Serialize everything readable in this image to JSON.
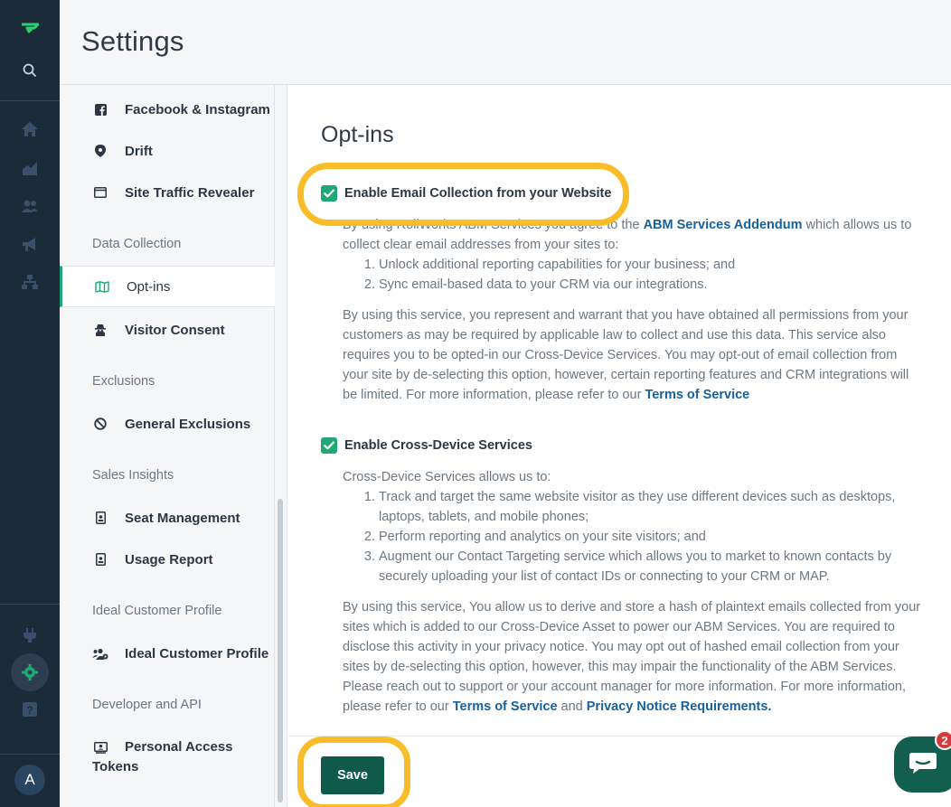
{
  "header": {
    "title": "Settings"
  },
  "rail": {
    "icons": [
      "brand-logo-icon",
      "search-icon",
      "home-icon",
      "chart-icon",
      "users-icon",
      "megaphone-icon",
      "org-chart-icon",
      "plug-icon",
      "gear-icon",
      "help-icon"
    ],
    "avatar_initial": "A"
  },
  "sidebar": {
    "items": [
      {
        "label": "Facebook & Instagram",
        "icon": "facebook-icon"
      },
      {
        "label": "Drift",
        "icon": "drift-icon"
      },
      {
        "label": "Site Traffic Revealer",
        "icon": "browser-window-icon"
      },
      {
        "label": "Opt-ins",
        "icon": "map-icon"
      },
      {
        "label": "Visitor Consent",
        "icon": "incognito-icon"
      },
      {
        "label": "General Exclusions",
        "icon": "ban-icon"
      },
      {
        "label": "Seat Management",
        "icon": "id-badge-icon"
      },
      {
        "label": "Usage Report",
        "icon": "id-badge-icon"
      },
      {
        "label": "Ideal Customer Profile",
        "icon": "users-cog-icon"
      },
      {
        "label": "Personal Access",
        "label2": "Tokens",
        "icon": "id-card-icon"
      }
    ],
    "sections": {
      "data_collection": "Data Collection",
      "exclusions": "Exclusions",
      "sales_insights": "Sales Insights",
      "ideal_customer_profile": "Ideal Customer Profile",
      "developer_api": "Developer and API"
    }
  },
  "main": {
    "title": "Opt-ins",
    "email_option": {
      "label": "Enable Email Collection from your Website",
      "checked": true,
      "intro_pre": "By using RollWorks ABM Services you agree to the ",
      "intro_link": "ABM Services Addendum",
      "intro_post": " which allows us to collect clear email addresses from your sites to:",
      "list": [
        "Unlock additional reporting capabilities for your business; and",
        "Sync email-based data to your CRM via our integrations."
      ],
      "para_pre": "By using this service, you represent and warrant that you have obtained all permissions from your customers as may be required by applicable law to collect and use this data. This service also requires you to be opted-in our Cross-Device Services. You may opt-out of email collection from your site by de-selecting this option, however, certain reporting features and CRM integrations will be limited. For more information, please refer to our ",
      "para_link": "Terms of Service"
    },
    "cross_device_option": {
      "label": "Enable Cross-Device Services",
      "checked": true,
      "intro": "Cross-Device Services allows us to:",
      "list": [
        "Track and target the same website visitor as they use different devices such as desktops, laptops, tablets, and mobile phones;",
        "Perform reporting and analytics on your site visitors; and",
        "Augment our Contact Targeting service which allows you to market to known contacts by securely uploading your list of contact IDs or connecting to your CRM or MAP."
      ],
      "para_pre": "By using this service, You allow us to derive and store a hash of plaintext emails collected from your sites which is added to our Cross-Device Asset to power our ABM Services. You are required to disclose this activity in your privacy notice. You may opt out of hashed email collection from your sites by de-selecting this option, however, this may impair the functionality of the ABM Services. Please reach out to support or your account manager for more information. For more information, please refer to our ",
      "para_link1": "Terms of Service",
      "para_mid": " and ",
      "para_link2": "Privacy Notice Requirements."
    },
    "save_label": "Save"
  },
  "chat": {
    "badge_count": "2"
  },
  "colors": {
    "accent_green": "#1fa774",
    "highlight": "#f9bd2a",
    "save_bg": "#0f5a4b",
    "link": "#17619e",
    "rail_bg": "#1c2b3a"
  }
}
